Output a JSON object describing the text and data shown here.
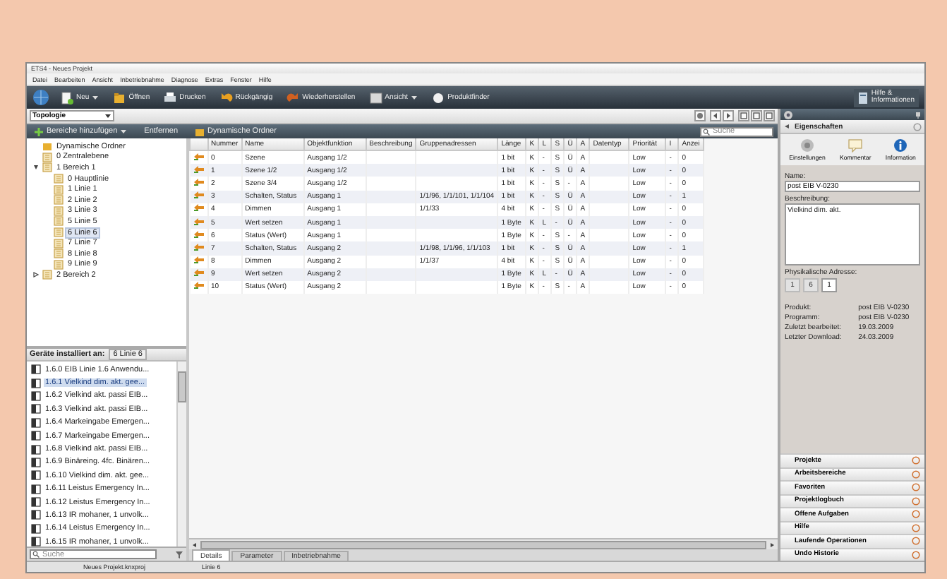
{
  "window": {
    "title": "ETS4 - Neues Projekt"
  },
  "menu": [
    "Datei",
    "Bearbeiten",
    "Ansicht",
    "Inbetriebnahme",
    "Diagnose",
    "Extras",
    "Fenster",
    "Hilfe"
  ],
  "toolbar": {
    "buttons": [
      {
        "label": "Neu",
        "dropdown": true
      },
      {
        "label": "Öffnen",
        "dropdown": false
      },
      {
        "label": "Drucken",
        "dropdown": false
      },
      {
        "label": "Rückgängig",
        "dropdown": false
      },
      {
        "label": "Wiederherstellen",
        "dropdown": false
      },
      {
        "label": "Ansicht",
        "dropdown": true
      },
      {
        "label": "Produktfinder",
        "dropdown": false
      }
    ],
    "help": [
      "Hilfe &",
      "Informationen"
    ]
  },
  "panel": {
    "view": "Topologie",
    "actions": [
      {
        "label": "Bereiche hinzufügen",
        "dropdown": true
      },
      {
        "label": "Entfernen",
        "dropdown": false
      },
      {
        "label": "Dynamische Ordner",
        "dropdown": false
      }
    ],
    "search": {
      "placeholder": "Suche"
    }
  },
  "tree": [
    {
      "label": "Dynamische Ordner",
      "selected": false
    },
    {
      "label": "0 Zentralebene",
      "selected": false
    },
    {
      "label": "1 Bereich 1",
      "selected": false,
      "expanded": true,
      "children": [
        {
          "label": "0 Hauptlinie",
          "selected": false
        },
        {
          "label": "1 Linie 1",
          "selected": false
        },
        {
          "label": "2 Linie 2",
          "selected": false
        },
        {
          "label": "3 Linie 3",
          "selected": false
        },
        {
          "label": "5 Linie 5",
          "selected": false
        },
        {
          "label": "6 Linie 6",
          "selected": true
        },
        {
          "label": "7 Linie 7",
          "selected": false
        },
        {
          "label": "8 Linie 8",
          "selected": false
        },
        {
          "label": "9 Linie 9",
          "selected": false
        }
      ]
    },
    {
      "label": "2 Bereich 2",
      "selected": false,
      "expanded": false
    }
  ],
  "devices": {
    "heading": "Geräte installiert an:",
    "location": "6 Linie 6",
    "items": [
      {
        "label": "1.6.0 EIB Linie 1.6 Anwendu...",
        "selected": false
      },
      {
        "label": "1.6.1 Vielkind dim. akt. gee...",
        "selected": true
      },
      {
        "label": "1.6.2 Vielkind akt. passi EIB...",
        "selected": false
      },
      {
        "label": "1.6.3 Vielkind akt. passi EIB...",
        "selected": false
      },
      {
        "label": "1.6.4 Markeingabe Emergen...",
        "selected": false
      },
      {
        "label": "1.6.7 Markeingabe Emergen...",
        "selected": false
      },
      {
        "label": "1.6.8 Vielkind akt. passi EIB...",
        "selected": false
      },
      {
        "label": "1.6.9 Binäreing. 4fc. Binären...",
        "selected": false
      },
      {
        "label": "1.6.10 Vielkind dim. akt. gee...",
        "selected": false
      },
      {
        "label": "1.6.11 Leistus Emergency In...",
        "selected": false
      },
      {
        "label": "1.6.12 Leistus Emergency In...",
        "selected": false
      },
      {
        "label": "1.6.13 IR mohaner, 1 unvolk...",
        "selected": false
      },
      {
        "label": "1.6.14 Leistus Emergency In...",
        "selected": false
      },
      {
        "label": "1.6.15 IR mohaner, 1 unvolk...",
        "selected": false
      }
    ],
    "search": {
      "placeholder": "Suche"
    }
  },
  "table": {
    "columns": [
      "Nummer",
      "Name",
      "Objektfunktion",
      "Beschreibung",
      "Gruppenadressen",
      "Länge",
      "K",
      "L",
      "S",
      "Ü",
      "A",
      "Datentyp",
      "Priorität",
      "I",
      "Anzei"
    ],
    "rows": [
      {
        "cells": [
          "0",
          "Szene",
          "Ausgang 1/2",
          "",
          "",
          "1 bit",
          "K",
          "-",
          "S",
          "Ü",
          "A",
          "",
          "Low",
          "-",
          "0"
        ]
      },
      {
        "cells": [
          "1",
          "Szene 1/2",
          "Ausgang 1/2",
          "",
          "",
          "1 bit",
          "K",
          "-",
          "S",
          "Ü",
          "A",
          "",
          "Low",
          "-",
          "0"
        ]
      },
      {
        "cells": [
          "2",
          "Szene 3/4",
          "Ausgang 1/2",
          "",
          "",
          "1 bit",
          "K",
          "-",
          "S",
          "-",
          "A",
          "",
          "Low",
          "-",
          "0"
        ]
      },
      {
        "cells": [
          "3",
          "Schalten, Status",
          "Ausgang 1",
          "",
          "1/1/96, 1/1/101, 1/1/104",
          "1 bit",
          "K",
          "-",
          "S",
          "Ü",
          "A",
          "",
          "Low",
          "-",
          "1"
        ]
      },
      {
        "cells": [
          "4",
          "Dimmen",
          "Ausgang 1",
          "",
          "1/1/33",
          "4 bit",
          "K",
          "-",
          "S",
          "Ü",
          "A",
          "",
          "Low",
          "-",
          "0"
        ]
      },
      {
        "cells": [
          "5",
          "Wert setzen",
          "Ausgang 1",
          "",
          "",
          "1 Byte",
          "K",
          "L",
          "-",
          "Ü",
          "A",
          "",
          "Low",
          "-",
          "0"
        ]
      },
      {
        "cells": [
          "6",
          "Status (Wert)",
          "Ausgang 1",
          "",
          "",
          "1 Byte",
          "K",
          "-",
          "S",
          "-",
          "A",
          "",
          "Low",
          "-",
          "0"
        ]
      },
      {
        "cells": [
          "7",
          "Schalten, Status",
          "Ausgang 2",
          "",
          "1/1/98, 1/1/96, 1/1/103",
          "1 bit",
          "K",
          "-",
          "S",
          "Ü",
          "A",
          "",
          "Low",
          "-",
          "1"
        ]
      },
      {
        "cells": [
          "8",
          "Dimmen",
          "Ausgang 2",
          "",
          "1/1/37",
          "4 bit",
          "K",
          "-",
          "S",
          "Ü",
          "A",
          "",
          "Low",
          "-",
          "0"
        ]
      },
      {
        "cells": [
          "9",
          "Wert setzen",
          "Ausgang 2",
          "",
          "",
          "1 Byte",
          "K",
          "L",
          "-",
          "Ü",
          "A",
          "",
          "Low",
          "-",
          "0"
        ]
      },
      {
        "cells": [
          "10",
          "Status (Wert)",
          "Ausgang 2",
          "",
          "",
          "1 Byte",
          "K",
          "-",
          "S",
          "-",
          "A",
          "",
          "Low",
          "-",
          "0"
        ]
      }
    ]
  },
  "tabs": [
    {
      "label": "Details",
      "selected": true
    },
    {
      "label": "Parameter",
      "selected": false
    },
    {
      "label": "Inbetriebnahme",
      "selected": false
    }
  ],
  "properties": {
    "title": "Eigenschaften",
    "buttons": [
      "Einstellungen",
      "Kommentar",
      "Information"
    ],
    "name_label": "Name:",
    "name": "post EIB V-0230",
    "description_label": "Beschreibung:",
    "description": "Vielkind dim. akt.",
    "address_label": "Physikalische Adresse:",
    "address": [
      {
        "value": "1",
        "disabled": true
      },
      {
        "value": "6",
        "disabled": true
      },
      {
        "value": "1",
        "disabled": false
      }
    ],
    "info": [
      {
        "label": "Produkt:",
        "value": "post EIB V-0230"
      },
      {
        "label": "Programm:",
        "value": "post EIB V-0230"
      },
      {
        "label": "Zuletzt bearbeitet:",
        "value": "19.03.2009"
      },
      {
        "label": "Letzter Download:",
        "value": "24.03.2009"
      }
    ]
  },
  "accordion": [
    "Projekte",
    "Arbeitsbereiche",
    "Favoriten",
    "Projektlogbuch",
    "Offene Aufgaben",
    "Hilfe",
    "Laufende Operationen",
    "Undo Historie"
  ],
  "status_bar": [
    "Neues Projekt.knxproj",
    "Linie 6"
  ]
}
